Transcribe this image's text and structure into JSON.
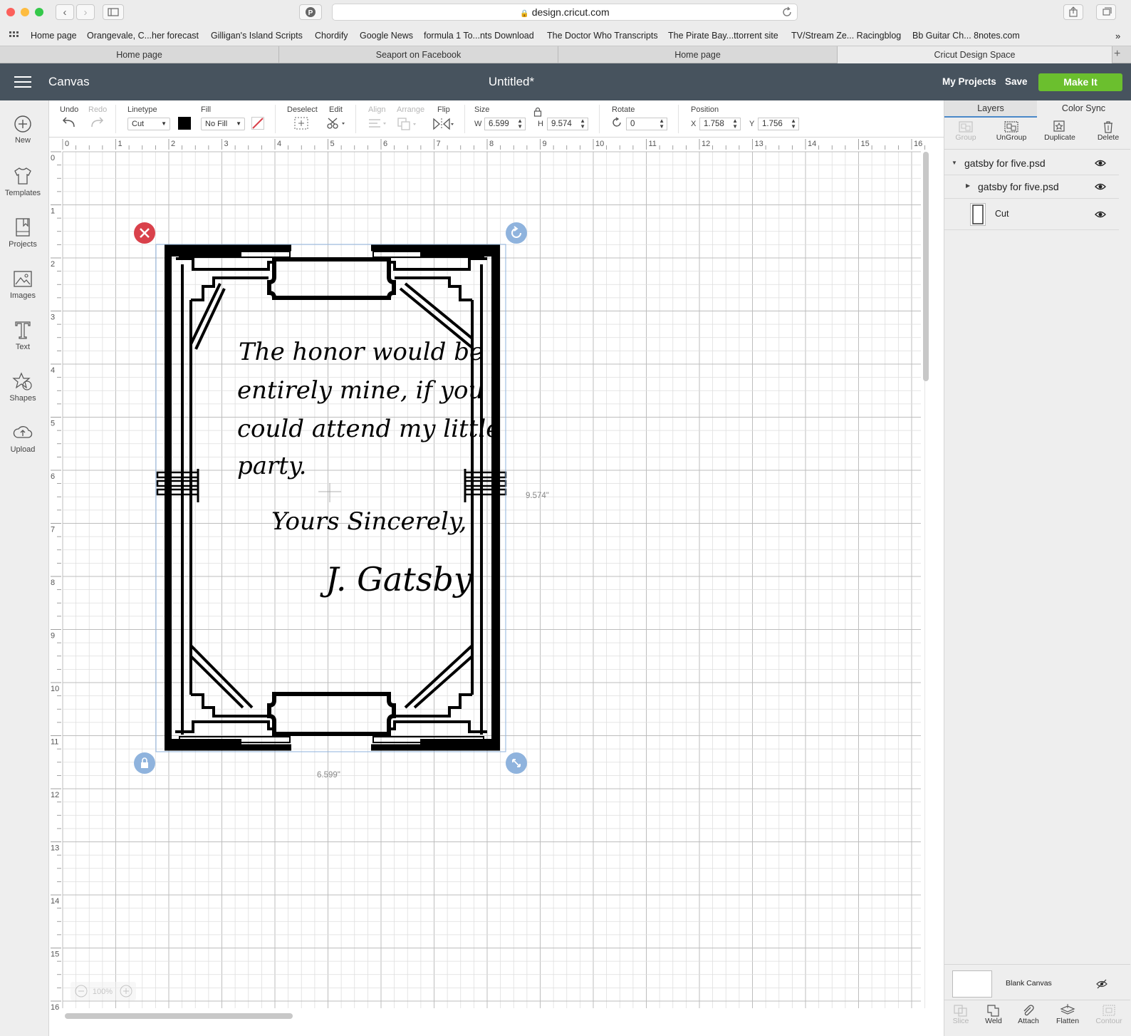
{
  "browser": {
    "url": "design.cricut.com",
    "bookmarks": [
      "Home page",
      "Orangevale, C...her forecast",
      "Gilligan's Island Scripts",
      "Chordify",
      "Google News",
      "formula 1 To...nts Download",
      "The Doctor Who Transcripts",
      "The Pirate Bay...ttorrent site",
      "TV/Stream Ze... Racingblog",
      "Bb Guitar Ch... 8notes.com"
    ],
    "tabs": [
      "Home page",
      "Seaport on Facebook",
      "Home page",
      "Cricut Design Space"
    ],
    "active_tab": 3
  },
  "header": {
    "section": "Canvas",
    "title": "Untitled*",
    "my_projects": "My Projects",
    "save": "Save",
    "make_it": "Make It"
  },
  "sidebar": {
    "new": "New",
    "templates": "Templates",
    "projects": "Projects",
    "images": "Images",
    "text": "Text",
    "shapes": "Shapes",
    "upload": "Upload"
  },
  "toolbar": {
    "undo": "Undo",
    "redo": "Redo",
    "linetype_label": "Linetype",
    "linetype_value": "Cut",
    "fill_label": "Fill",
    "fill_value": "No Fill",
    "deselect": "Deselect",
    "edit": "Edit",
    "align": "Align",
    "arrange": "Arrange",
    "flip": "Flip",
    "size_label": "Size",
    "w_label": "W",
    "w_value": "6.599",
    "h_label": "H",
    "h_value": "9.574",
    "rotate_label": "Rotate",
    "rotate_value": "0",
    "position_label": "Position",
    "x_label": "X",
    "x_value": "1.758",
    "y_label": "Y",
    "y_value": "1.756",
    "linetype_color": "#000000"
  },
  "panel": {
    "tab_layers": "Layers",
    "tab_color_sync": "Color Sync",
    "group": "Group",
    "ungroup": "UnGroup",
    "duplicate": "Duplicate",
    "delete": "Delete",
    "layers": [
      {
        "name": "gatsby for five.psd",
        "level": 0,
        "expanded": true
      },
      {
        "name": "gatsby for five.psd",
        "level": 1,
        "expanded": false
      },
      {
        "name": "Cut",
        "level": 1
      }
    ],
    "blank_canvas": "Blank Canvas",
    "slice": "Slice",
    "weld": "Weld",
    "attach": "Attach",
    "flatten": "Flatten",
    "contour": "Contour"
  },
  "canvas": {
    "ruler_labels": [
      "0",
      "1",
      "2",
      "3",
      "4",
      "5",
      "6",
      "7",
      "8",
      "9",
      "10",
      "11",
      "12",
      "13",
      "14",
      "15",
      "16"
    ],
    "width_readout": "6.599\"",
    "height_readout": "9.574\"",
    "zoom": "100%",
    "invite_lines": [
      "The honor would be",
      "entirely mine, if you",
      "could attend my little",
      "party."
    ],
    "closing": "Yours Sincerely,",
    "signature": "J. Gatsby"
  },
  "colors": {
    "header_bg": "#47535e",
    "make_it_green": "#6bbf2e",
    "delete_handle_red": "#d9414b",
    "handle_blue": "#8fb3dd",
    "grid_line": "#d4d4d4"
  }
}
